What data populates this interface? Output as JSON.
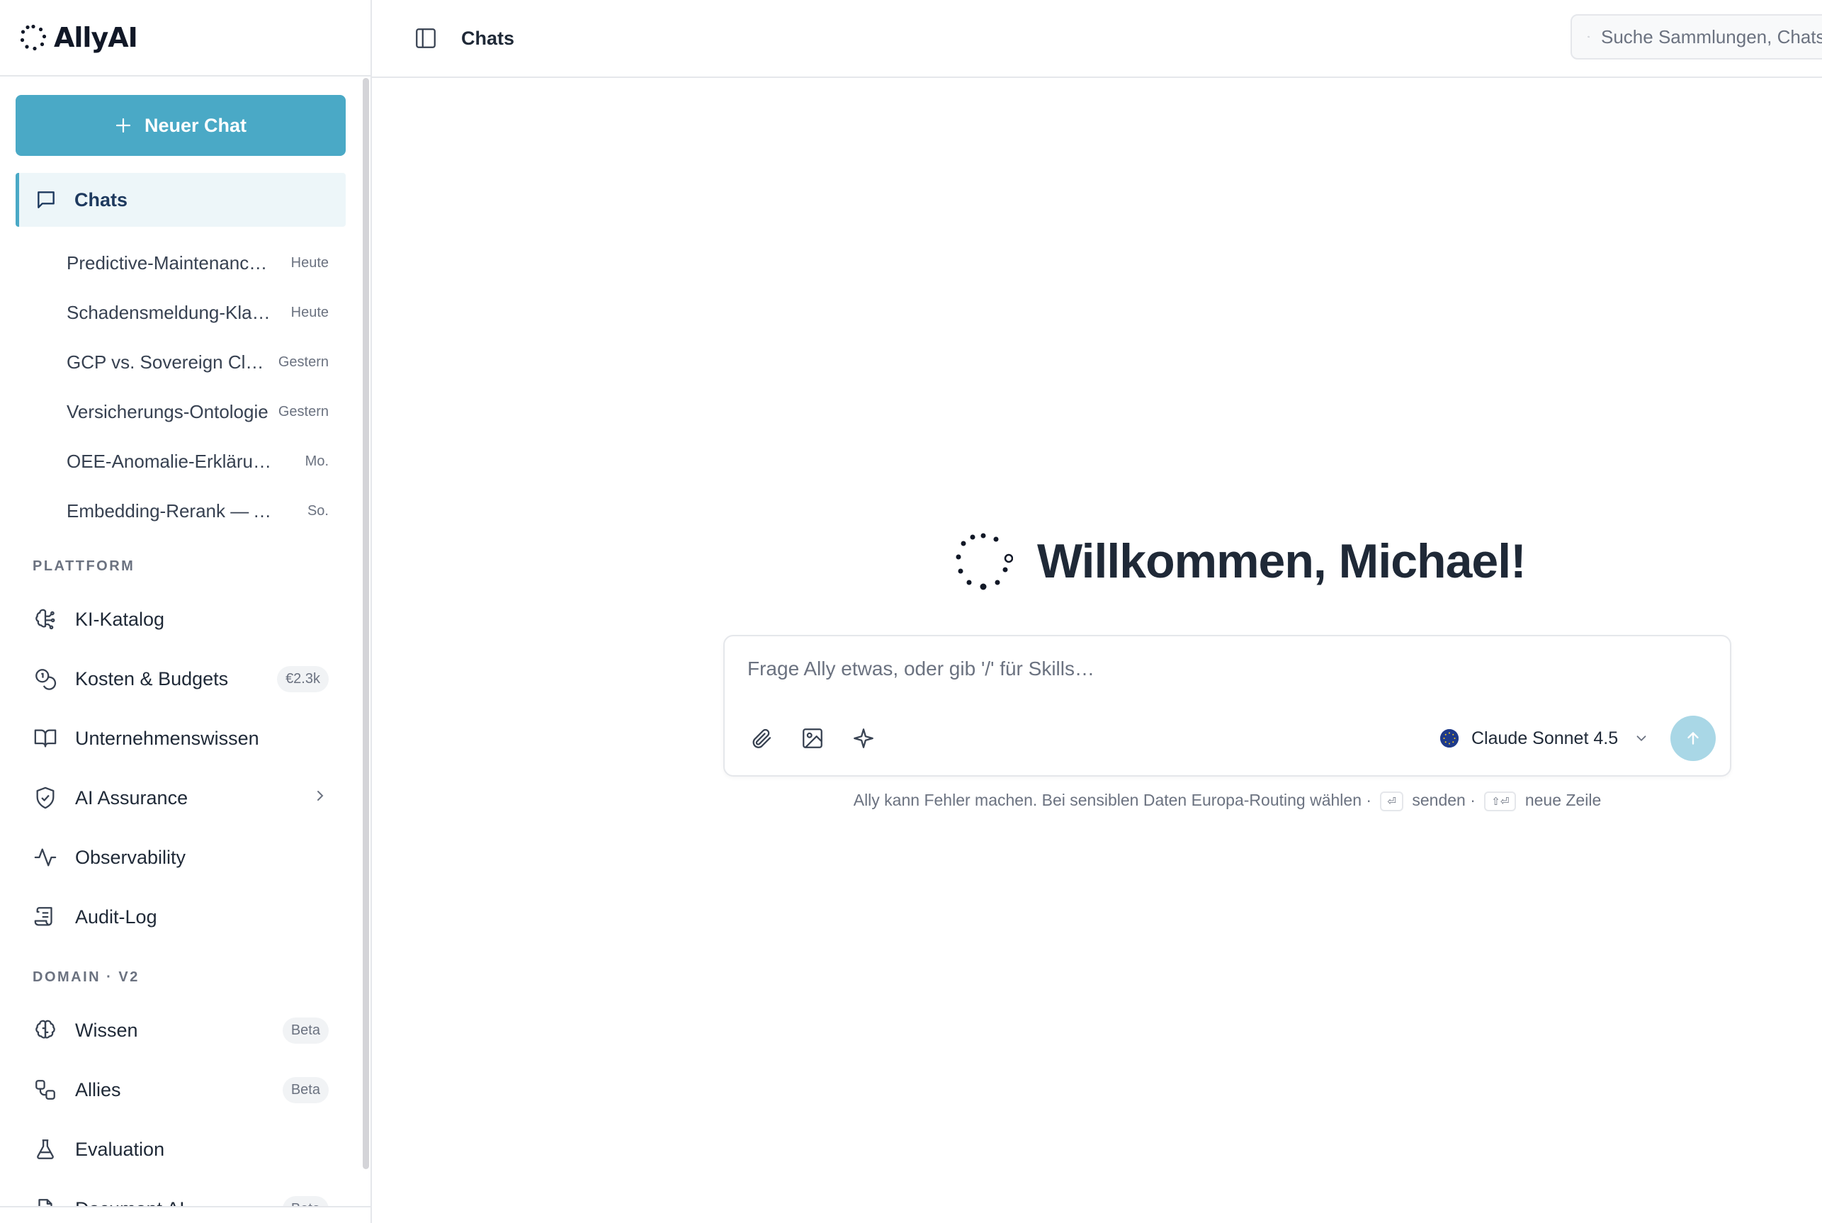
{
  "brand": {
    "name": "AllyAI"
  },
  "sidebar": {
    "new_chat_label": "Neuer Chat",
    "chats_label": "Chats",
    "chats": [
      {
        "title": "Predictive-Maintenance-…",
        "date": "Heute"
      },
      {
        "title": "Schadensmeldung-Klassifikation",
        "date": "Heute"
      },
      {
        "title": "GCP vs. Sovereign Cloud",
        "date": "Gestern"
      },
      {
        "title": "Versicherungs-Ontologie",
        "date": "Gestern"
      },
      {
        "title": "OEE-Anomalie-Erklärung…",
        "date": "Mo."
      },
      {
        "title": "Embedding-Rerank — Analyse",
        "date": "So."
      }
    ],
    "section_platform": "PLATTFORM",
    "platform_items": [
      {
        "label": "KI-Katalog",
        "icon": "brain-circuit-icon"
      },
      {
        "label": "Kosten & Budgets",
        "icon": "coins-icon",
        "badge": "€2.3k"
      },
      {
        "label": "Unternehmenswissen",
        "icon": "book-open-icon"
      },
      {
        "label": "AI Assurance",
        "icon": "shield-check-icon"
      },
      {
        "label": "Observability",
        "icon": "activity-icon"
      },
      {
        "label": "Audit-Log",
        "icon": "scroll-icon"
      }
    ],
    "section_domain": "DOMAIN · V2",
    "domain_items": [
      {
        "label": "Wissen",
        "icon": "brain-icon",
        "badge": "Beta"
      },
      {
        "label": "Allies",
        "icon": "workflow-icon",
        "badge": "Beta"
      },
      {
        "label": "Evaluation",
        "icon": "flask-icon"
      },
      {
        "label": "Document AI",
        "icon": "file-icon",
        "badge": "Beta"
      }
    ]
  },
  "topbar": {
    "breadcrumb": "Chats",
    "search_placeholder": "Suche Sammlungen, Chats"
  },
  "main": {
    "welcome": "Willkommen, Michael!",
    "composer_placeholder": "Frage Ally etwas, oder gib '/' für Skills…",
    "model_label": "Claude Sonnet 4.5",
    "hint_text": "Ally kann Fehler machen. Bei sensiblen Daten Europa-Routing wählen ·",
    "hint_send": "senden ·",
    "hint_newline": "neue Zeile",
    "kbd_enter": "⏎",
    "kbd_shift_enter": "⇧⏎"
  },
  "colors": {
    "accent": "#4aa9c6",
    "accent_light": "#edf6f9",
    "send_disabled": "#a9d7e6"
  }
}
